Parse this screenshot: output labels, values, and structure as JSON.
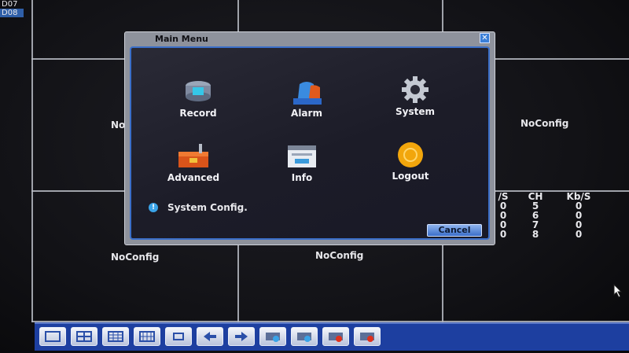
{
  "channels": {
    "items": [
      "D07",
      "D08"
    ],
    "selected": "D08"
  },
  "grid_labels": {
    "ch_mid_left": "No",
    "ch_mid_right": "NoConfig",
    "ch_bottom_left": "NoConfig",
    "ch_bottom_center": "NoConfig"
  },
  "stats": {
    "headers": [
      "/S",
      "CH",
      "Kb/S"
    ],
    "rows": [
      [
        "0",
        "5",
        "0"
      ],
      [
        "0",
        "6",
        "0"
      ],
      [
        "0",
        "7",
        "0"
      ],
      [
        "0",
        "8",
        "0"
      ]
    ]
  },
  "dialog": {
    "title": "Main Menu",
    "close_glyph": "✕",
    "items": [
      {
        "label": "Record",
        "icon": "record-icon"
      },
      {
        "label": "Alarm",
        "icon": "alarm-icon"
      },
      {
        "label": "System",
        "icon": "gear-icon"
      },
      {
        "label": "Advanced",
        "icon": "toolbox-icon"
      },
      {
        "label": "Info",
        "icon": "info-window-icon"
      },
      {
        "label": "Logout",
        "icon": "power-icon"
      }
    ],
    "status_text": "System Config.",
    "cancel_label": "Cancel"
  },
  "toolbar": {
    "buttons": [
      "single-view-icon",
      "quad-view-icon",
      "nine-view-icon",
      "sixteen-view-icon",
      "fullscreen-icon",
      "previous-icon",
      "next-icon",
      "playback-icon",
      "record-control-icon",
      "ptz-icon",
      "color-icon"
    ]
  },
  "colors": {
    "accent": "#3b6fc9",
    "toolbar": "#1d3fa0",
    "selected": "#2f5fa8",
    "logout": "#f2a60c"
  }
}
